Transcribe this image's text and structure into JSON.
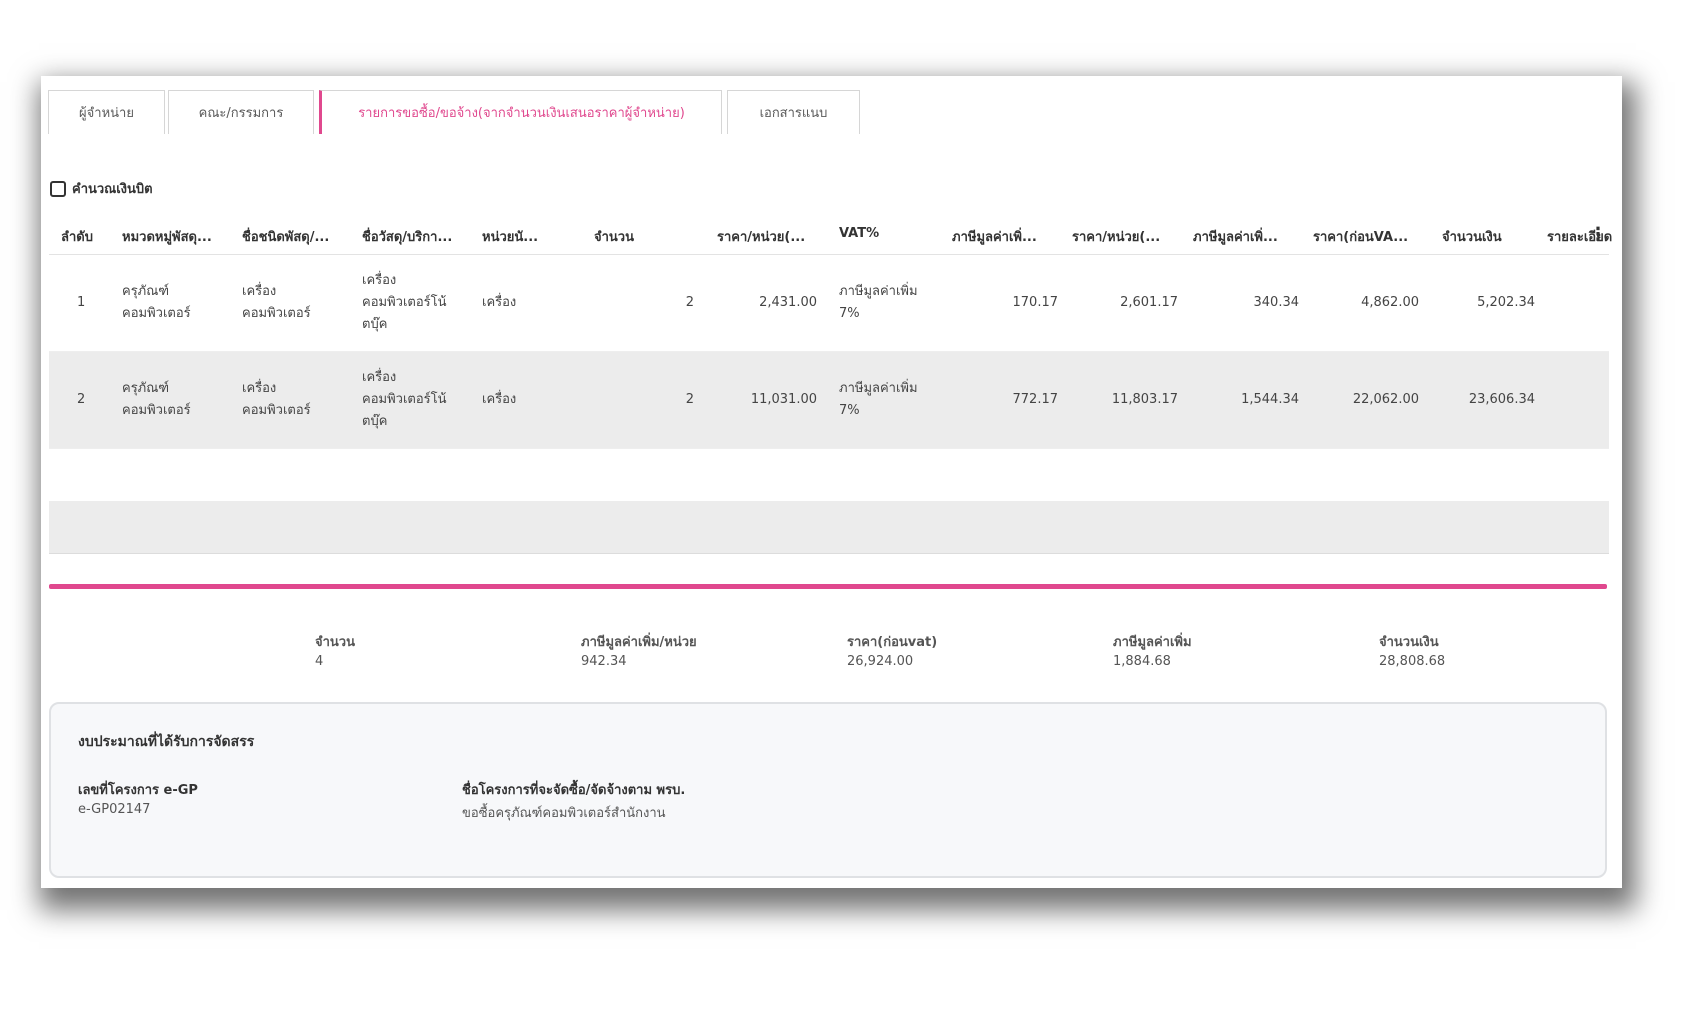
{
  "tabs": [
    {
      "label": "ผู้จำหน่าย"
    },
    {
      "label": "คณะ/กรรมการ"
    },
    {
      "label": "รายการขอซื้อ/ขอจ้าง(จากจำนวนเงินเสนอราคาผู้จำหน่าย)",
      "active": true
    },
    {
      "label": "เอกสารแนบ"
    }
  ],
  "calc_label": "คำนวณเงินบิต",
  "table": {
    "headers": [
      "ลำดับ",
      "หมวดหมู่พัสดุ...",
      "ชื่อชนิดพัสดุ/...",
      "ชื่อวัสดุ/บริกา...",
      "หน่วยนั...",
      "จำนวน",
      "ราคา/หน่วย(...",
      "VAT%",
      "ภาษีมูลค่าเพิ่...",
      "ราคา/หน่วย(...",
      "ภาษีมูลค่าเพิ่...",
      "ราคา(ก่อนVA...",
      "จำนวนเงิน",
      "รายละเอียด"
    ],
    "rows": [
      {
        "no": "1",
        "category_l1": "ครุภัณฑ์",
        "category_l2": "คอมพิวเตอร์",
        "type_l1": "เครื่อง",
        "type_l2": "คอมพิวเตอร์",
        "item_l1": "เครื่อง",
        "item_l2": "คอมพิวเตอร์โน้",
        "item_l3": "ตบุ๊ค",
        "unit": "เครื่อง",
        "qty": "2",
        "unit_price": "2,431.00",
        "vat_l1": "ภาษีมูลค่าเพิ่ม",
        "vat_l2": "7%",
        "vat_amount": "170.17",
        "unit_price_vat": "2,601.17",
        "vat_total": "340.34",
        "price_before_vat": "4,862.00",
        "amount": "5,202.34",
        "detail": ""
      },
      {
        "no": "2",
        "category_l1": "ครุภัณฑ์",
        "category_l2": "คอมพิวเตอร์",
        "type_l1": "เครื่อง",
        "type_l2": "คอมพิวเตอร์",
        "item_l1": "เครื่อง",
        "item_l2": "คอมพิวเตอร์โน้",
        "item_l3": "ตบุ๊ค",
        "unit": "เครื่อง",
        "qty": "2",
        "unit_price": "11,031.00",
        "vat_l1": "ภาษีมูลค่าเพิ่ม",
        "vat_l2": "7%",
        "vat_amount": "772.17",
        "unit_price_vat": "11,803.17",
        "vat_total": "1,544.34",
        "price_before_vat": "22,062.00",
        "amount": "23,606.34",
        "detail": ""
      }
    ]
  },
  "summary": [
    {
      "label": "จำนวน",
      "value": "4"
    },
    {
      "label": "ภาษีมูลค่าเพิ่ม/หน่วย",
      "value": "942.34"
    },
    {
      "label": "ราคา(ก่อนvat)",
      "value": "26,924.00"
    },
    {
      "label": "ภาษีมูลค่าเพิ่ม",
      "value": "1,884.68"
    },
    {
      "label": "จำนวนเงิน",
      "value": "28,808.68"
    }
  ],
  "budget": {
    "title": "งบประมาณที่ได้รับการจัดสรร",
    "project_no_label": "เลขที่โครงการ e-GP",
    "project_no": "e-GP02147",
    "project_name_label": "ชื่อโครงการที่จะจัดซื้อ/จัดจ้างตาม พรบ.",
    "project_name": "ขอซื้อครุภัณฑ์คอมพิวเตอร์สำนักงาน"
  },
  "colors": {
    "accent": "#e0488e",
    "row_alt": "#ececec"
  },
  "icons": {
    "more": "vertical-dots-icon",
    "checkbox": "checkbox-icon"
  }
}
